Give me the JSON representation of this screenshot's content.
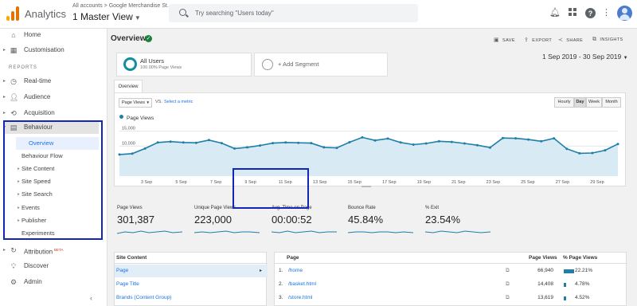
{
  "header": {
    "app_title": "Analytics",
    "account_crumb": "All accounts > Google Merchandise St...",
    "view_name": "1 Master View",
    "search_placeholder": "Try searching \"Users today\"",
    "logo_colors": [
      "#f9ab00",
      "#e37400",
      "#e37400"
    ]
  },
  "sidebar": {
    "home": "Home",
    "customisation": "Customisation",
    "reports_section": "REPORTS",
    "realtime": "Real-time",
    "audience": "Audience",
    "acquisition": "Acquisition",
    "behaviour": "Behaviour",
    "behaviour_items": [
      "Overview",
      "Behaviour Flow",
      "Site Content",
      "Site Speed",
      "Site Search",
      "Events",
      "Publisher",
      "Experiments"
    ],
    "attribution": "Attribution",
    "attribution_badge": "BETA",
    "discover": "Discover",
    "admin": "Admin"
  },
  "main": {
    "title": "Overview",
    "tools": {
      "save": "SAVE",
      "export": "EXPORT",
      "share": "SHARE",
      "insights": "INSIGHTS"
    },
    "date_range": "1 Sep 2019 - 30 Sep 2019",
    "segment": {
      "name": "All Users",
      "sub": "100.00% Page Views"
    },
    "add_segment": "+ Add Segment",
    "tab": "Overview",
    "metric_select": "Page Views",
    "vs": "VS.",
    "select_metric": "Select a metric",
    "granularity": [
      "Hourly",
      "Day",
      "Week",
      "Month"
    ],
    "granularity_selected": "Day",
    "accent_color": "#1f7fa8"
  },
  "chart_data": {
    "type": "area",
    "series": [
      {
        "name": "Page Views",
        "values": [
          7200,
          7500,
          9200,
          11200,
          11500,
          11200,
          11100,
          12000,
          11000,
          9200,
          9600,
          10200,
          11000,
          11200,
          11100,
          11000,
          9600,
          9400,
          11300,
          12900,
          11900,
          12500,
          11200,
          10500,
          10900,
          11600,
          11400,
          10900,
          10300,
          9500,
          12700,
          12600,
          12200,
          11600,
          12600,
          9100,
          7600,
          7700,
          8600,
          10700
        ]
      }
    ],
    "x_tick_labels": [
      "3 Sep",
      "5 Sep",
      "7 Sep",
      "9 Sep",
      "11 Sep",
      "13 Sep",
      "15 Sep",
      "17 Sep",
      "19 Sep",
      "21 Sep",
      "23 Sep",
      "25 Sep",
      "27 Sep",
      "29 Sep"
    ],
    "y_tick_labels": [
      "15,000",
      "10,000"
    ],
    "ylim": [
      0,
      17000
    ],
    "grid": true,
    "legend": "top-left"
  },
  "scorecards": [
    {
      "label": "Page Views",
      "value": "301,387"
    },
    {
      "label": "Unique Page Views",
      "value": "223,000"
    },
    {
      "label": "Avg. Time on Page",
      "value": "00:00:52"
    },
    {
      "label": "Bounce Rate",
      "value": "45.84%"
    },
    {
      "label": "% Exit",
      "value": "23.54%"
    }
  ],
  "site_content": {
    "header": "Site Content",
    "rows": [
      "Page",
      "Page Title",
      "Brands (Content Group)"
    ]
  },
  "pages": {
    "headers": {
      "page": "Page",
      "views": "Page Views",
      "pct": "% Page Views"
    },
    "rows": [
      {
        "num": "1.",
        "page": "/home",
        "views": "66,940",
        "pct": "22.21%",
        "pct_value": 22.21
      },
      {
        "num": "2.",
        "page": "/basket.html",
        "views": "14,408",
        "pct": "4.78%",
        "pct_value": 4.78
      },
      {
        "num": "3.",
        "page": "/store.html",
        "views": "13,619",
        "pct": "4.52%",
        "pct_value": 4.52
      }
    ]
  }
}
